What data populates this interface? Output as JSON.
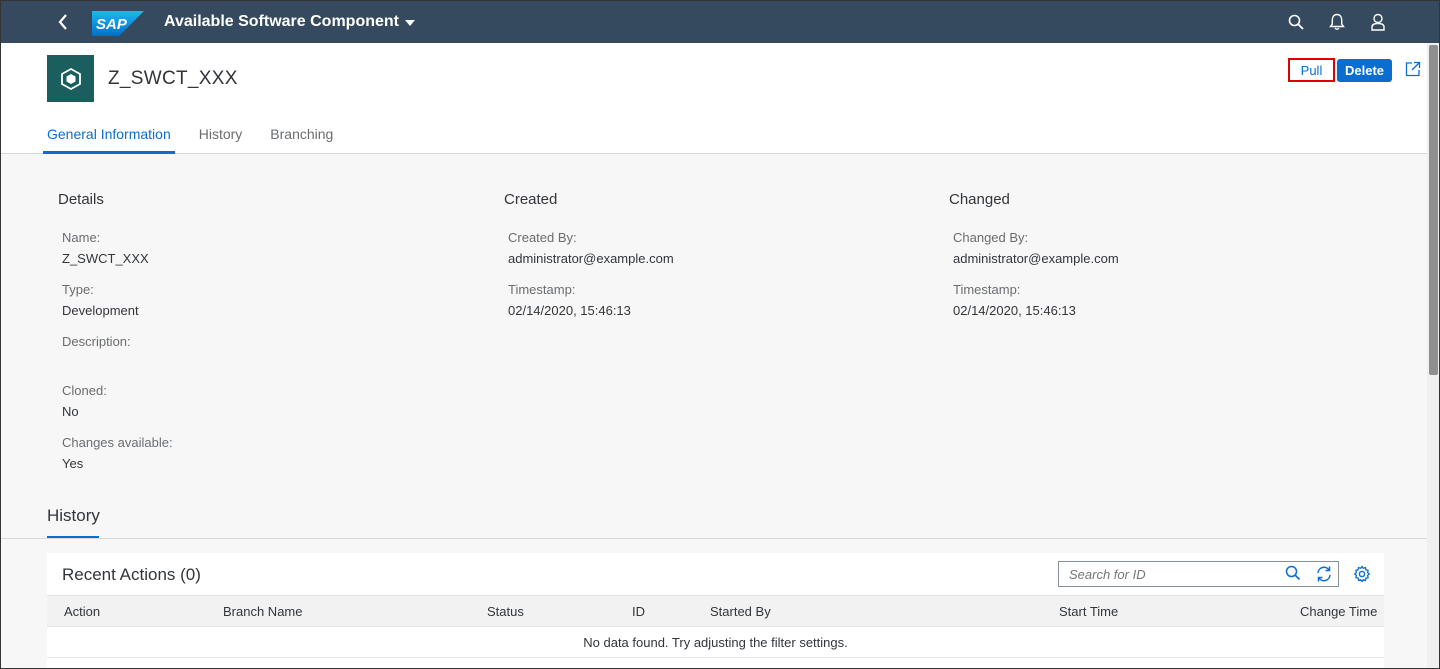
{
  "shell": {
    "logo_text": "SAP",
    "title": "Available Software Component",
    "icons": [
      "back-icon",
      "search-icon",
      "bell-icon",
      "user-icon"
    ]
  },
  "header": {
    "object_title": "Z_SWCT_XXX",
    "object_icon": "cube-icon",
    "actions": {
      "pull": "Pull",
      "delete": "Delete",
      "share_icon": "share-icon"
    },
    "tabs": [
      {
        "label": "General Information",
        "active": true
      },
      {
        "label": "History",
        "active": false
      },
      {
        "label": "Branching",
        "active": false
      }
    ]
  },
  "details": {
    "title": "Details",
    "name_label": "Name:",
    "name_value": "Z_SWCT_XXX",
    "type_label": "Type:",
    "type_value": "Development",
    "description_label": "Description:",
    "cloned_label": "Cloned:",
    "cloned_value": "No",
    "changes_label": "Changes available:",
    "changes_value": "Yes"
  },
  "created": {
    "title": "Created",
    "by_label": "Created By:",
    "by_value": "administrator@example.com",
    "timestamp_label": "Timestamp:",
    "timestamp_value": "02/14/2020, 15:46:13"
  },
  "changed": {
    "title": "Changed",
    "by_label": "Changed By:",
    "by_value": "administrator@example.com",
    "timestamp_label": "Timestamp:",
    "timestamp_value": "02/14/2020, 15:46:13"
  },
  "history": {
    "section_title": "History",
    "table_title": "Recent Actions (0)",
    "search_placeholder": "Search for ID",
    "columns": [
      "Action",
      "Branch Name",
      "Status",
      "ID",
      "Started By",
      "Start Time",
      "Change Time"
    ],
    "no_data": "No data found. Try adjusting the filter settings."
  },
  "colors": {
    "shell_bg": "#354a5f",
    "accent": "#0a6ed1",
    "object_icon_bg": "#1a5e5e",
    "highlight_border": "#e00000"
  }
}
